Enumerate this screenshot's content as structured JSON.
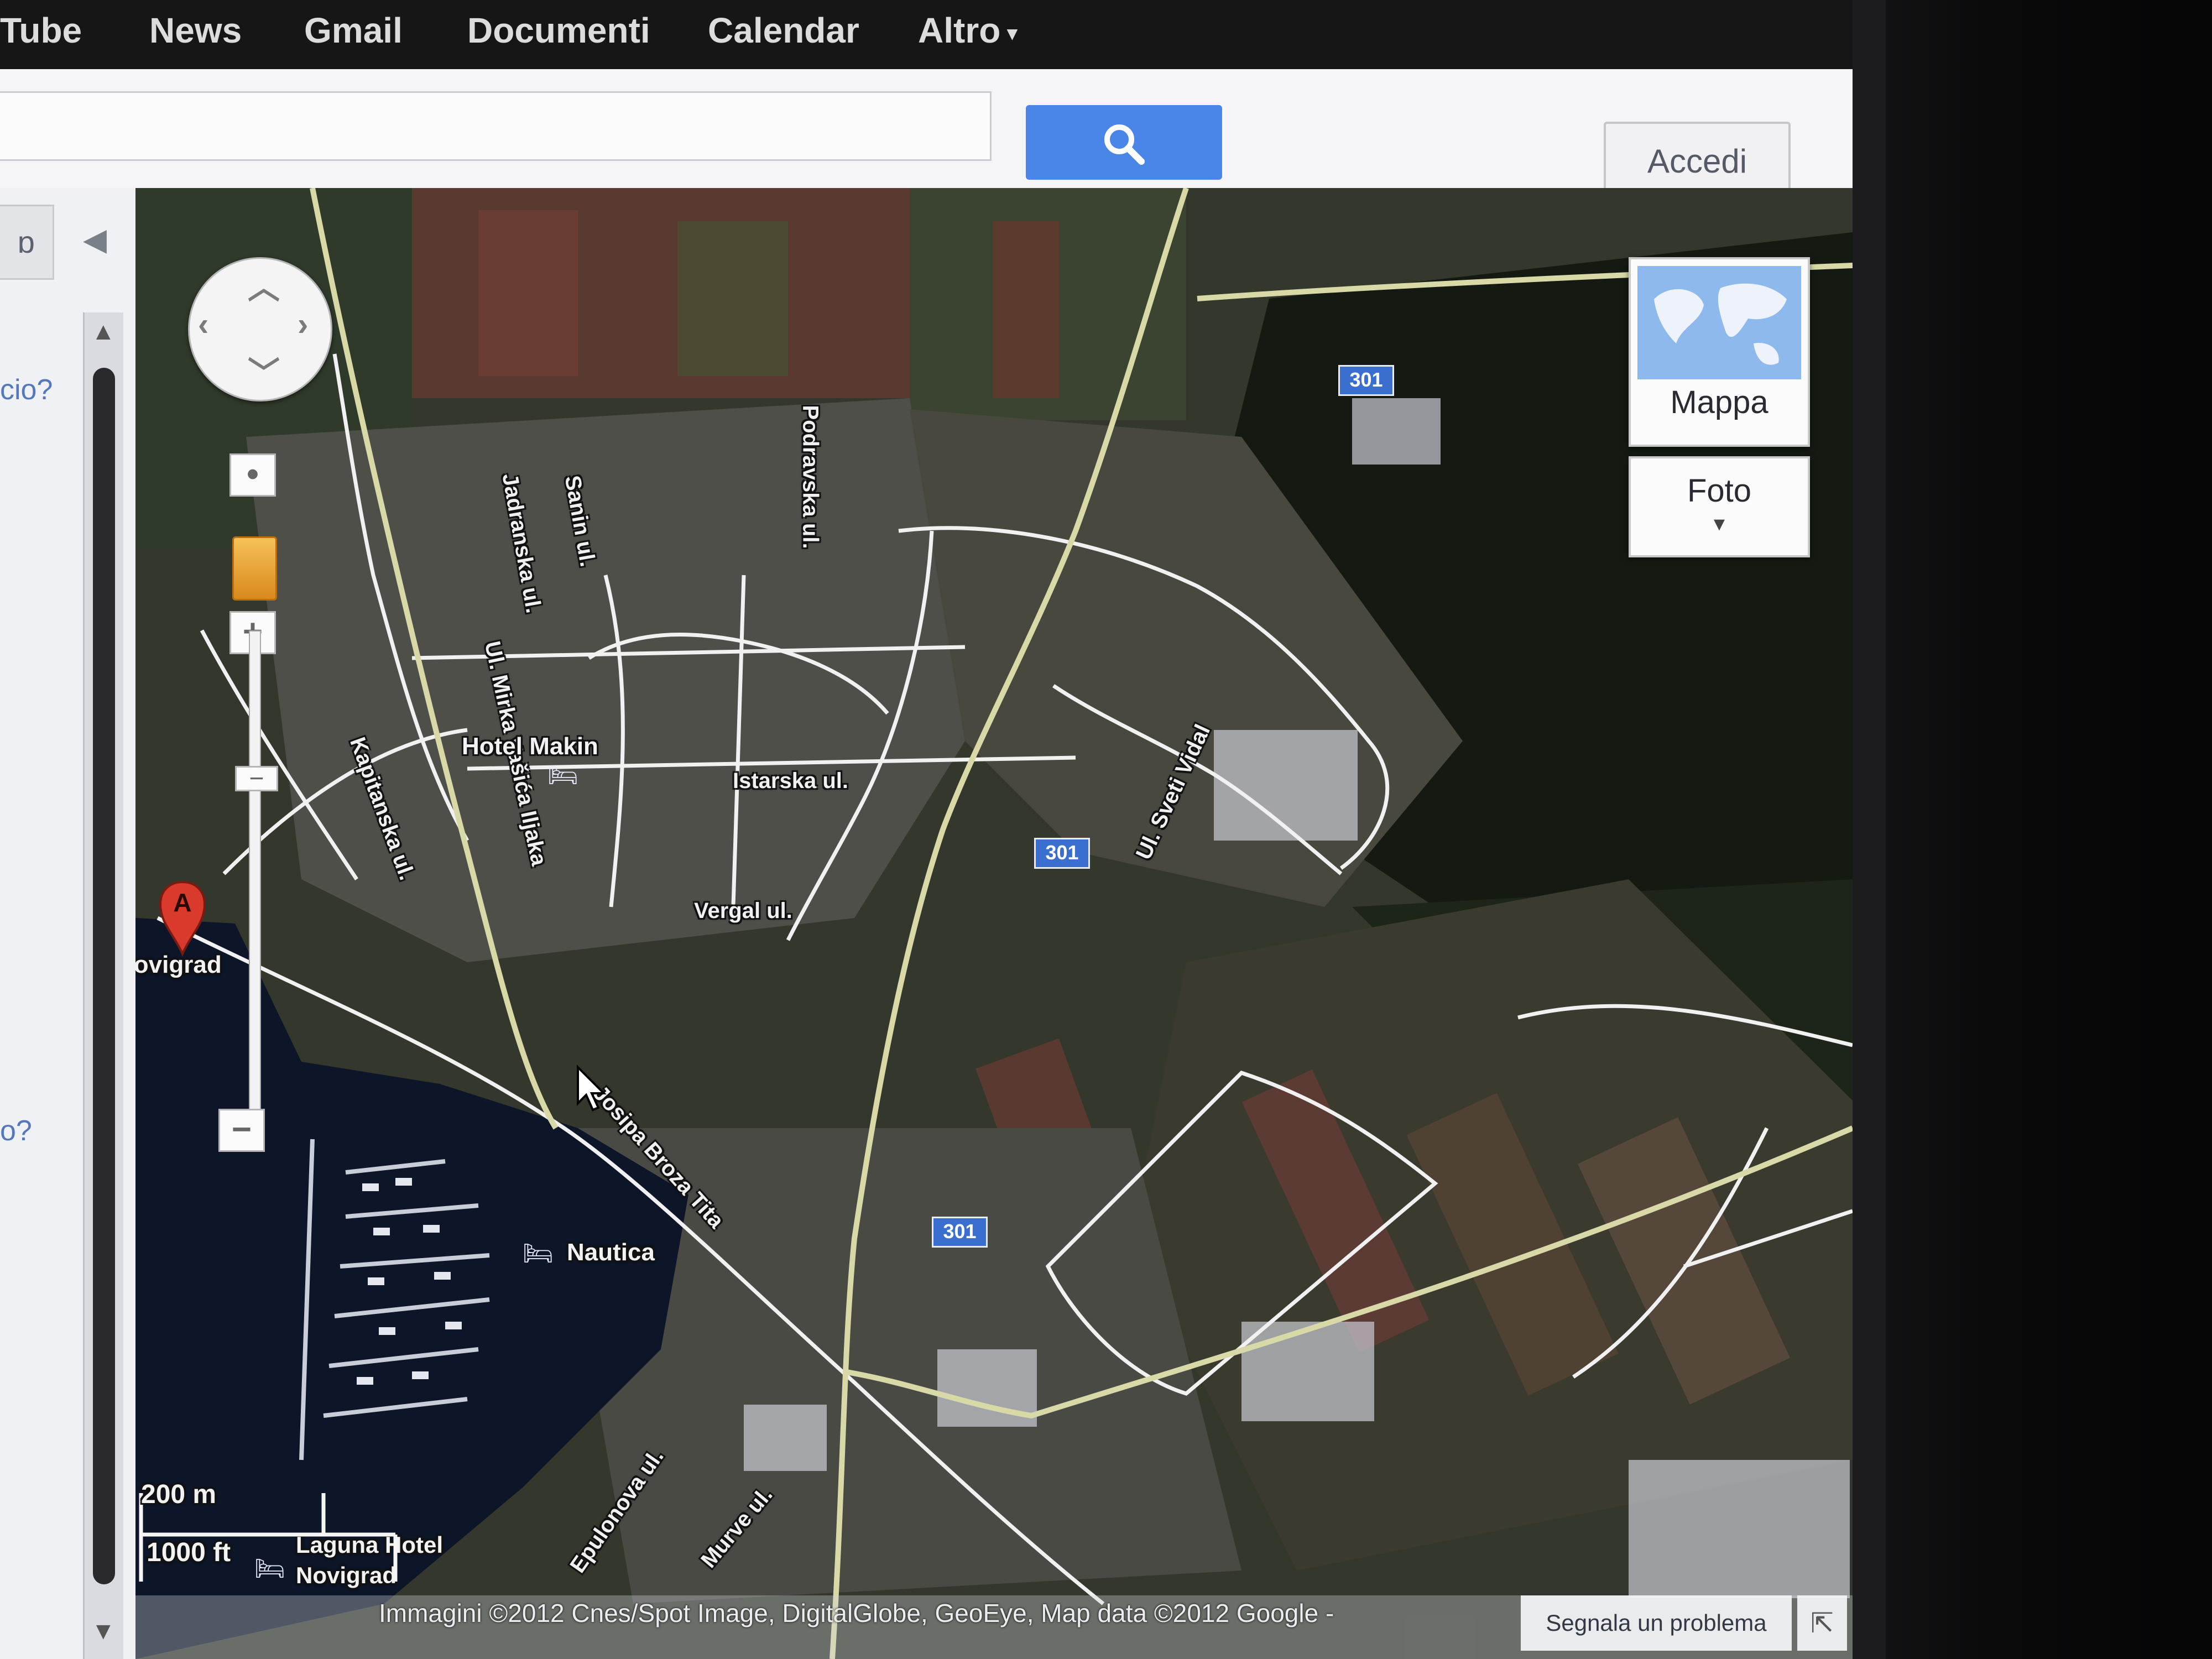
{
  "gbar": {
    "links": [
      "Tube",
      "News",
      "Gmail",
      "Documenti",
      "Calendar",
      "Altro"
    ]
  },
  "header": {
    "search_query": "",
    "signin_label": "Accedi"
  },
  "left_panel": {
    "tab_label": "ɒ",
    "question_1": "cio?",
    "question_2": "o?"
  },
  "map": {
    "type_controls": {
      "mappa": "Mappa",
      "foto": "Foto"
    },
    "marker": {
      "letter": "A",
      "label": "Novigrad"
    },
    "road_shields": [
      "301",
      "301",
      "301"
    ],
    "street_labels": [
      "Ul. Mirka Vašića Iljaka",
      "Jadranska ul.",
      "Sanin ul.",
      "Podravska ul.",
      "Kapitanska ul.",
      "Istarska ul.",
      "Vergal ul.",
      "Ul. Sveti Vidal",
      "Josipa Broza Tita",
      "Epulonova ul.",
      "Murve ul."
    ],
    "places": [
      "Hotel Makin",
      "Nautica",
      "Laguna Hotel",
      "Novigrad"
    ],
    "scale": {
      "metric": "200 m",
      "imperial": "1000 ft"
    },
    "attribution": "Immagini ©2012 Cnes/Spot Image, DigitalGlobe, GeoEye, Map data ©2012 Google -",
    "report_label": "Segnala un problema"
  },
  "colors": {
    "gbar_bg": "#161616",
    "search_blue": "#4a86e8",
    "road_shield_blue": "#3a6fd0",
    "marker_red": "#d93a2b"
  }
}
